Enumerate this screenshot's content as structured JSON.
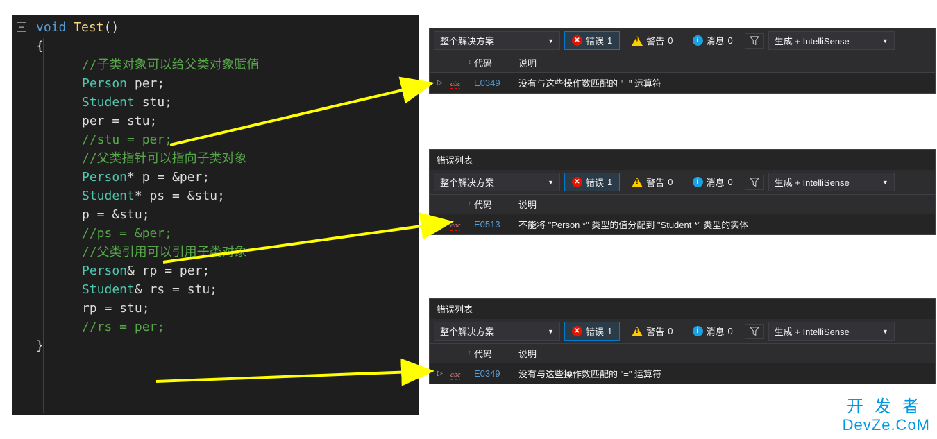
{
  "code": {
    "l1_kw": "void",
    "l1_fn": "Test",
    "l1_par": "()",
    "l2": "{",
    "l3": "//子类对象可以给父类对象赋值",
    "l4_t": "Person",
    "l4_id": " per;",
    "l5_t": "Student",
    "l5_id": " stu;",
    "l6": "per = stu;",
    "l7": "//stu = per;",
    "l8": "",
    "l9": "//父类指针可以指向子类对象",
    "l10_t": "Person",
    "l10_rest": "* p = &per;",
    "l11_t": "Student",
    "l11_rest": "* ps = &stu;",
    "l12": "p = &stu;",
    "l13": "//ps = &per;",
    "l14": "",
    "l15": "//父类引用可以引用子类对象",
    "l16_t": "Person",
    "l16_rest": "& rp = per;",
    "l17_t": "Student",
    "l17_rest": "& rs = stu;",
    "l18": "rp = stu;",
    "l19": "//rs = per;",
    "l20": "}"
  },
  "panel": {
    "title": "错误列表",
    "scope": "整个解决方案",
    "err_label": "错误",
    "err_count": "1",
    "warn_label": "警告",
    "warn_count": "0",
    "msg_label": "消息",
    "msg_count": "0",
    "build": "生成 + IntelliSense",
    "col_code": "代码",
    "col_desc": "说明"
  },
  "errors": {
    "e1": {
      "code": "E0349",
      "desc": "没有与这些操作数匹配的 \"=\" 运算符"
    },
    "e2": {
      "code": "E0513",
      "desc": "不能将 \"Person *\" 类型的值分配到 \"Student *\" 类型的实体"
    },
    "e3": {
      "code": "E0349",
      "desc": "没有与这些操作数匹配的 \"=\" 运算符"
    }
  },
  "watermark": {
    "top": "开发者",
    "bot": "DevZe.CoM"
  }
}
